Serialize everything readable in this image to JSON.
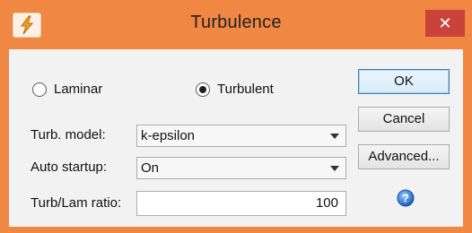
{
  "window": {
    "title": "Turbulence",
    "close_icon": "close-icon",
    "app_icon": "lightning-app-icon",
    "colors": {
      "frame": "#f08743",
      "close": "#c9433a",
      "client": "#f2f2f2"
    }
  },
  "flow_mode": {
    "options": [
      {
        "label": "Laminar",
        "selected": false
      },
      {
        "label": "Turbulent",
        "selected": true
      }
    ]
  },
  "fields": {
    "turb_model": {
      "label": "Turb. model:",
      "value": "k-epsilon"
    },
    "auto_startup": {
      "label": "Auto startup:",
      "value": "On"
    },
    "ratio": {
      "label": "Turb/Lam ratio:",
      "value": "100"
    }
  },
  "buttons": {
    "ok": "OK",
    "cancel": "Cancel",
    "advanced": "Advanced...",
    "help_icon": "help-icon"
  }
}
